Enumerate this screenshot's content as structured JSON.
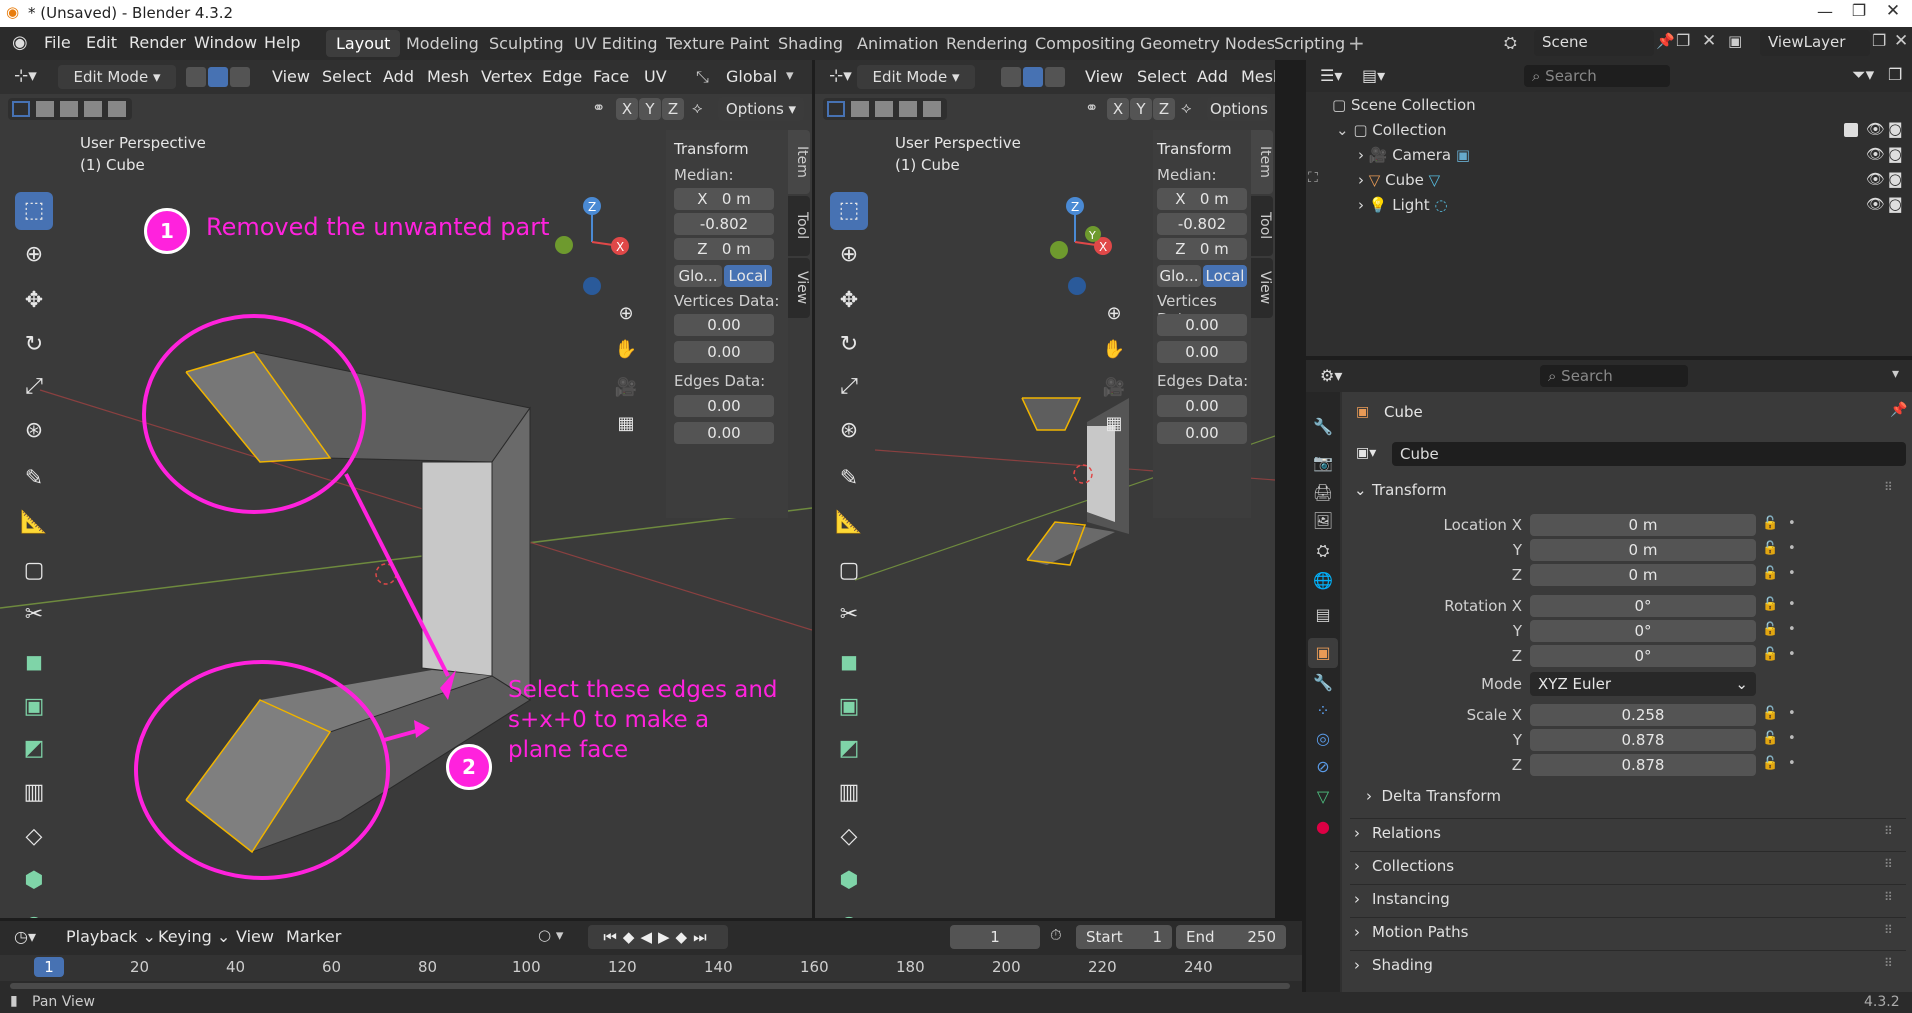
{
  "window": {
    "title": "* (Unsaved) - Blender 4.3.2"
  },
  "menus": [
    "File",
    "Edit",
    "Render",
    "Window",
    "Help"
  ],
  "workspaces": [
    {
      "label": "Layout",
      "active": true
    },
    {
      "label": "Modeling"
    },
    {
      "label": "Sculpting"
    },
    {
      "label": "UV Editing"
    },
    {
      "label": "Texture Paint"
    },
    {
      "label": "Shading"
    },
    {
      "label": "Animation"
    },
    {
      "label": "Rendering"
    },
    {
      "label": "Compositing"
    },
    {
      "label": "Geometry Nodes"
    },
    {
      "label": "Scripting"
    }
  ],
  "scene": {
    "name": "Scene",
    "view_layer": "ViewLayer"
  },
  "viewport_left": {
    "mode": "Edit Mode",
    "menus": [
      "View",
      "Select",
      "Add",
      "Mesh",
      "Vertex",
      "Edge",
      "Face",
      "UV"
    ],
    "orientation": "Global",
    "options": "Options",
    "perspective": "User Perspective",
    "object": "(1) Cube",
    "transform_title": "Transform",
    "median_label": "Median:",
    "x_label": "X",
    "x_val": "0 m",
    "y_val": "-0.802",
    "z_label": "Z",
    "z_val": "0 m",
    "glo": "Glo...",
    "local": "Local",
    "vertices_label": "Vertices Data:",
    "v1": "0.00",
    "v2": "0.00",
    "edges_label": "Edges Data:",
    "e1": "0.00",
    "e2": "0.00",
    "tabs": [
      "Item",
      "Tool",
      "View"
    ],
    "axes": [
      "X",
      "Y",
      "Z"
    ]
  },
  "viewport_right": {
    "mode": "Edit Mode",
    "menus": [
      "View",
      "Select",
      "Add",
      "Mesh"
    ],
    "options": "Options",
    "perspective": "User Perspective",
    "object": "(1) Cube",
    "transform_title": "Transform",
    "median_label": "Median:",
    "x_label": "X",
    "x_val": "0 m",
    "y_val": "-0.802",
    "z_label": "Z",
    "z_val": "0 m",
    "glo": "Glo...",
    "local": "Local",
    "vertices_label": "Vertices Data:",
    "v1": "0.00",
    "v2": "0.00",
    "edges_label": "Edges Data:",
    "e1": "0.00",
    "e2": "0.00",
    "tabs": [
      "Item",
      "Tool",
      "View"
    ],
    "axes": [
      "X",
      "Y",
      "Z"
    ]
  },
  "annotations": {
    "n1": "1",
    "text1": "Removed the unwanted part",
    "n2": "2",
    "text2_l1": "Select these edges and",
    "text2_l2": "s+x+0 to make a",
    "text2_l3": "plane face"
  },
  "outliner": {
    "search_placeholder": "Search",
    "root": "Scene Collection",
    "collection": "Collection",
    "items": [
      "Camera",
      "Cube",
      "Light"
    ]
  },
  "properties": {
    "search_placeholder": "Search",
    "object": "Cube",
    "data": "Cube",
    "transform": "Transform",
    "location_x_lbl": "Location X",
    "y_lbl": "Y",
    "z_lbl": "Z",
    "loc_x": "0 m",
    "loc_y": "0 m",
    "loc_z": "0 m",
    "rotation_x_lbl": "Rotation X",
    "rot_x": "0°",
    "rot_y": "0°",
    "rot_z": "0°",
    "mode_lbl": "Mode",
    "mode_val": "XYZ Euler",
    "scale_x_lbl": "Scale X",
    "scale_x": "0.258",
    "scale_y": "0.878",
    "scale_z": "0.878",
    "delta": "Delta Transform",
    "panels": [
      "Relations",
      "Collections",
      "Instancing",
      "Motion Paths",
      "Shading"
    ]
  },
  "timeline": {
    "menus": [
      "Playback",
      "Keying",
      "View",
      "Marker"
    ],
    "current": "1",
    "start_lbl": "Start",
    "start": "1",
    "end_lbl": "End",
    "end": "250",
    "ticks": [
      "1",
      "20",
      "40",
      "60",
      "80",
      "100",
      "120",
      "140",
      "160",
      "180",
      "200",
      "220",
      "240"
    ]
  },
  "status": {
    "left": "Pan View",
    "version": "4.3.2"
  },
  "colors": {
    "accent": "#4772b3",
    "annotation": "#ff22dd",
    "selected_edge": "#f0b400"
  }
}
